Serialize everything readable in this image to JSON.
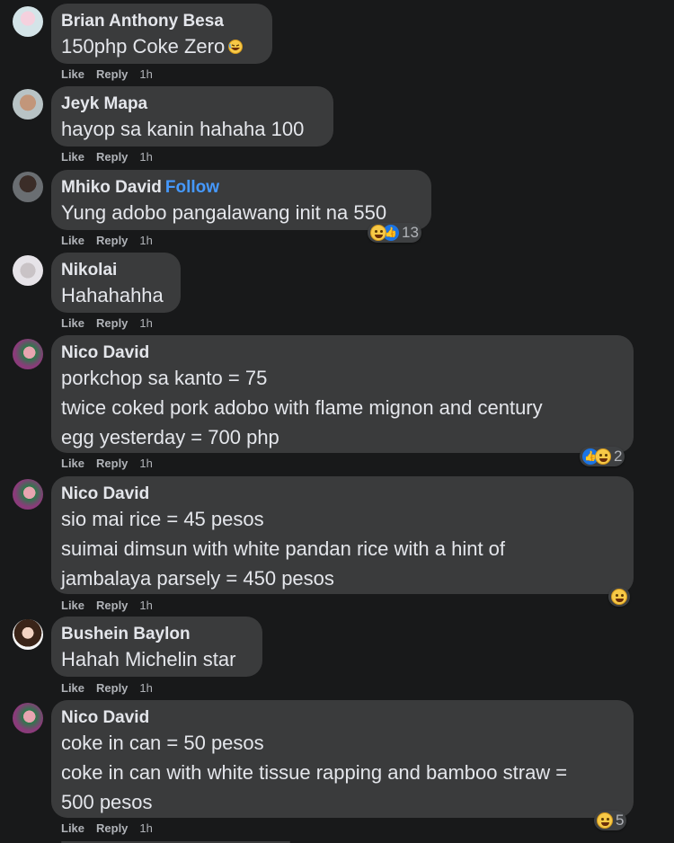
{
  "actions": {
    "like": "Like",
    "reply": "Reply"
  },
  "comments": [
    {
      "author": "Brian Anthony Besa",
      "text": [
        "150php Coke Zero"
      ],
      "time": "1h",
      "inline_emoji": "laughing-emoji-icon"
    },
    {
      "author": "Jeyk Mapa",
      "text": [
        "hayop sa kanin hahaha 100"
      ],
      "time": "1h"
    },
    {
      "author": "Mhiko David",
      "follow": "Follow",
      "text": [
        "Yung adobo pangalawang init na 550"
      ],
      "time": "1h",
      "reactions": {
        "icons": [
          "haha-reaction-icon",
          "like-reaction-icon"
        ],
        "count": "13"
      }
    },
    {
      "author": "Nikolai",
      "text": [
        "Hahahahha"
      ],
      "time": "1h"
    },
    {
      "author": "Nico David",
      "text": [
        "porkchop sa kanto = 75",
        "twice coked pork adobo with flame mignon and century",
        "egg yesterday = 700 php"
      ],
      "time": "1h",
      "reactions": {
        "icons": [
          "like-reaction-icon",
          "haha-reaction-icon"
        ],
        "count": "2"
      }
    },
    {
      "author": "Nico David",
      "text": [
        "sio mai rice = 45 pesos",
        "suimai dimsun with white pandan rice with a hint of",
        "jambalaya parsely = 450 pesos"
      ],
      "time": "1h",
      "reactions": {
        "icons": [
          "haha-reaction-icon"
        ],
        "count": ""
      }
    },
    {
      "author": "Bushein Baylon",
      "text": [
        "Hahah Michelin star"
      ],
      "time": "1h"
    },
    {
      "author": "Nico David",
      "text": [
        "coke in can = 50 pesos",
        "coke in can with white tissue rapping and bamboo straw =",
        "500 pesos"
      ],
      "time": "1h",
      "reactions": {
        "icons": [
          "haha-reaction-icon"
        ],
        "count": "5"
      }
    }
  ]
}
